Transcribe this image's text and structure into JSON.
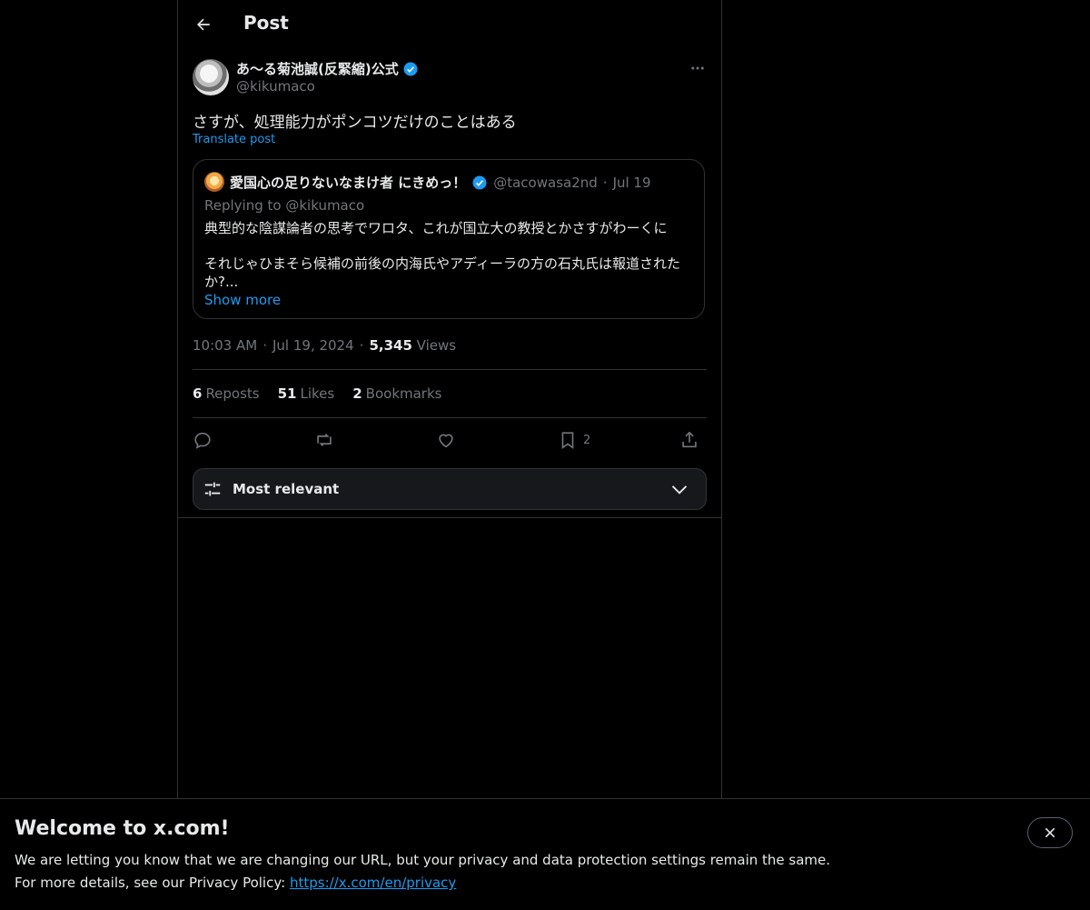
{
  "header": {
    "title": "Post"
  },
  "post": {
    "author_name": "あ〜る菊池誠(反緊縮)公式",
    "author_handle": "@kikumaco",
    "text": "さすが、処理能力がポンコツだけのことはある",
    "translate_label": "Translate post",
    "time": "10:03 AM",
    "date": "Jul 19, 2024",
    "views_count": "5,345",
    "views_label": "Views",
    "separator": "·"
  },
  "quote": {
    "author_name": "愛国心の足りないなまけ者 にきめっ！",
    "author_handle": "@tacowasa2nd",
    "separator": "·",
    "date": "Jul 19",
    "replying_prefix": "Replying to",
    "replying_handle": "@kikumaco",
    "line1": "典型的な陰謀論者の思考でワロタ、これが国立大の教授とかさすがわーくに",
    "line2": "それじゃひまそら候補の前後の内海氏やアディーラの方の石丸氏は報道されたか?...",
    "show_more": "Show more"
  },
  "stats": {
    "reposts_count": "6",
    "reposts_label": "Reposts",
    "likes_count": "51",
    "likes_label": "Likes",
    "bookmarks_count": "2",
    "bookmarks_label": "Bookmarks"
  },
  "actions": {
    "bookmark_count": "2",
    "icons": [
      "reply-icon",
      "repost-icon",
      "like-icon",
      "bookmark-icon",
      "share-icon"
    ]
  },
  "sort": {
    "label": "Most relevant"
  },
  "banner": {
    "title": "Welcome to x.com!",
    "line1": "We are letting you know that we are changing our URL, but your privacy and data protection settings remain the same.",
    "line2_prefix": "For more details, see our Privacy Policy:",
    "link": "https://x.com/en/privacy"
  },
  "colors": {
    "background": "#000000",
    "text": "#e7e9ea",
    "muted": "#71767b",
    "accent": "#1d9bf0",
    "border": "#2f3336"
  }
}
